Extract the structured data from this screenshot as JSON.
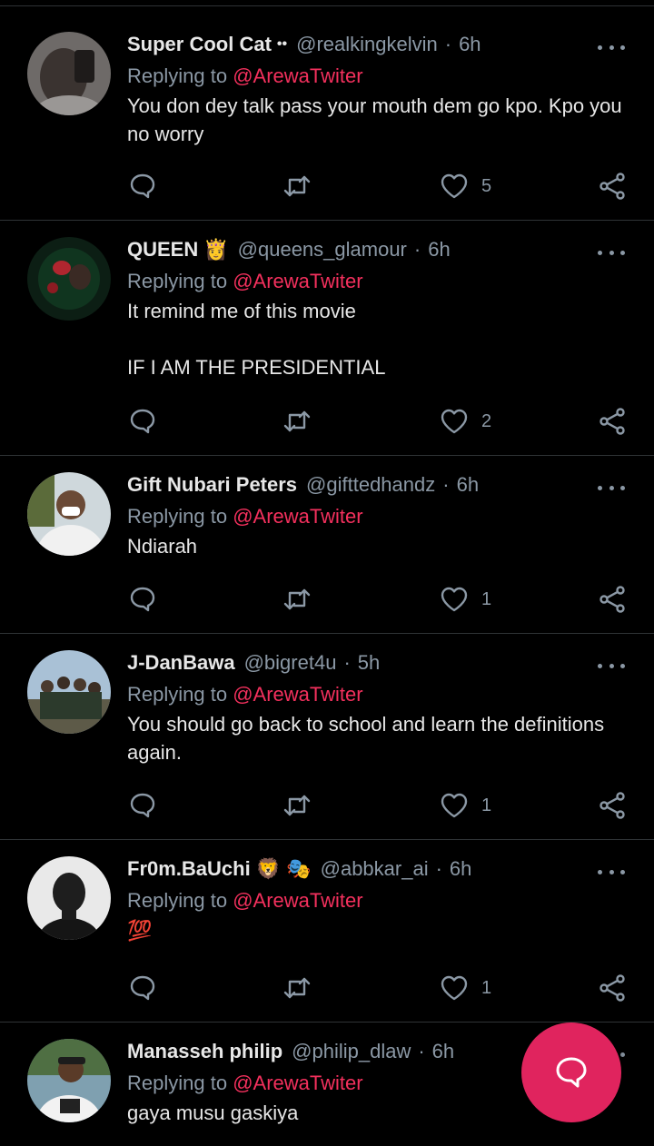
{
  "colors": {
    "accent": "#e0245e",
    "mention": "#f3305d",
    "secondary": "#8b98a5",
    "background": "#000000"
  },
  "icons": {
    "reply": "reply-bubble-icon",
    "retweet": "retweet-icon",
    "like": "heart-icon",
    "share": "share-icon",
    "more": "more-icon",
    "compose": "compose-reply-icon"
  },
  "tweets": [
    {
      "name": "Super Cool Cat",
      "name_suffix": "••",
      "handle": "@realkingkelvin",
      "time": "6h",
      "replying_prefix": "Replying to",
      "replying_to": "@ArewaTwiter",
      "text": "You don dey talk pass your mouth dem go kpo. Kpo you no worry",
      "likes": "5"
    },
    {
      "name": "QUEEN",
      "name_suffix": "👸",
      "handle": "@queens_glamour",
      "time": "6h",
      "replying_prefix": "Replying to",
      "replying_to": "@ArewaTwiter",
      "text": "It remind me of this movie\n\nIF I AM THE PRESIDENTIAL",
      "likes": "2"
    },
    {
      "name": "Gift Nubari Peters",
      "name_suffix": "",
      "handle": "@gifttedhandz",
      "time": "6h",
      "replying_prefix": "Replying to",
      "replying_to": "@ArewaTwiter",
      "text": "Ndiarah",
      "likes": "1"
    },
    {
      "name": "J-DanBawa",
      "name_suffix": "",
      "handle": "@bigret4u",
      "time": "5h",
      "replying_prefix": "Replying to",
      "replying_to": "@ArewaTwiter",
      "text": "You should go back to school and learn the definitions again.",
      "likes": "1"
    },
    {
      "name": "Fr0m.BaUchi",
      "name_suffix": "🦁 🎭",
      "handle": "@abbkar_ai",
      "time": "6h",
      "replying_prefix": "Replying to",
      "replying_to": "@ArewaTwiter",
      "text": "💯",
      "likes": "1"
    },
    {
      "name": "Manasseh philip",
      "name_suffix": "",
      "handle": "@philip_dlaw",
      "time": "6h",
      "replying_prefix": "Replying to",
      "replying_to": "@ArewaTwiter",
      "text": "gaya musu gaskiya",
      "likes": ""
    }
  ]
}
